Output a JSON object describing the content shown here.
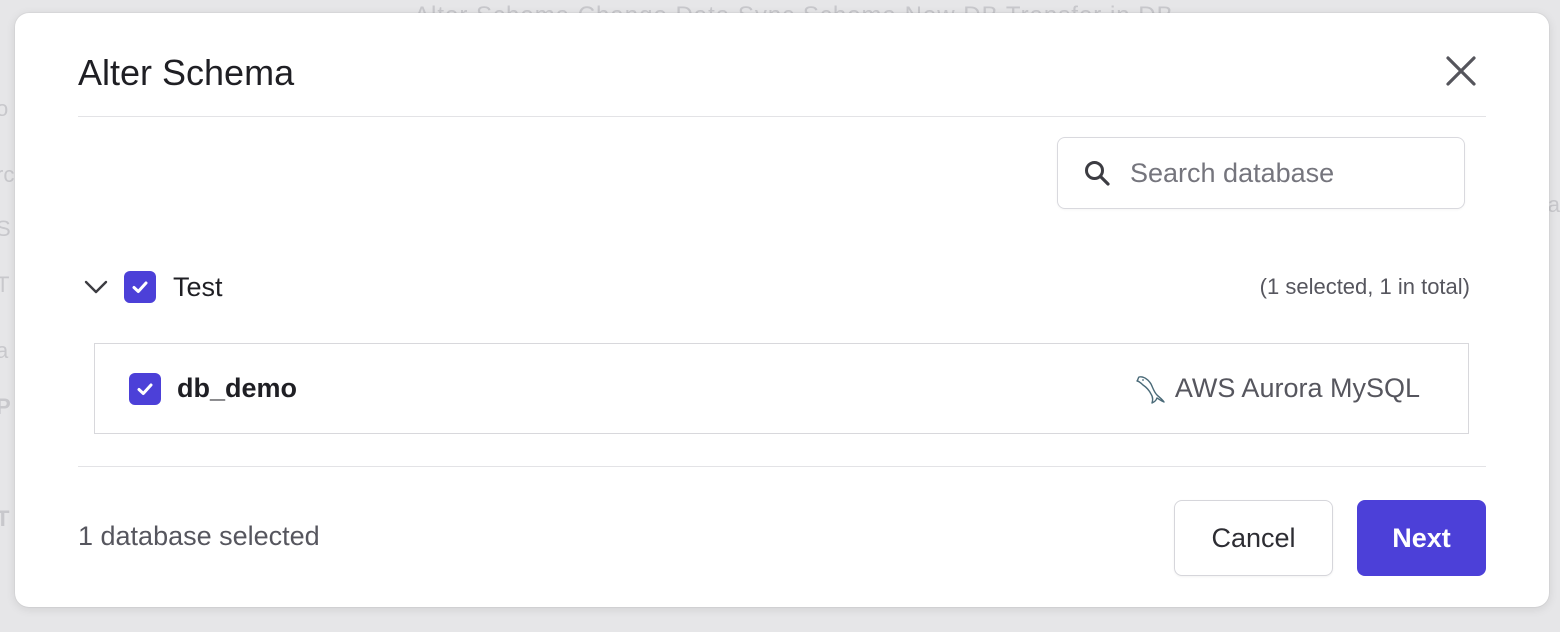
{
  "background": {
    "top_text": "Alter Schema     Change Data     Sync Schema     New DB     Transfer in DB",
    "side_fragments": [
      "o",
      "rc",
      "S",
      "T",
      "a",
      "P",
      "T"
    ],
    "right_fragment": "a"
  },
  "modal": {
    "title": "Alter Schema",
    "close_icon": "close-icon"
  },
  "search": {
    "placeholder": "Search database",
    "value": "",
    "icon": "search-icon"
  },
  "group": {
    "name": "Test",
    "checked": true,
    "expanded": true,
    "count_text": "(1 selected, 1 in total)"
  },
  "databases": [
    {
      "name": "db_demo",
      "checked": true,
      "engine": "AWS Aurora MySQL",
      "engine_icon": "mysql-dolphin-icon"
    }
  ],
  "footer": {
    "status_text": "1 database selected",
    "cancel_label": "Cancel",
    "next_label": "Next"
  },
  "colors": {
    "accent": "#4c40d8",
    "overlay": "#e6e6e8",
    "text_primary": "#1f1f24",
    "text_secondary": "#56565e"
  }
}
